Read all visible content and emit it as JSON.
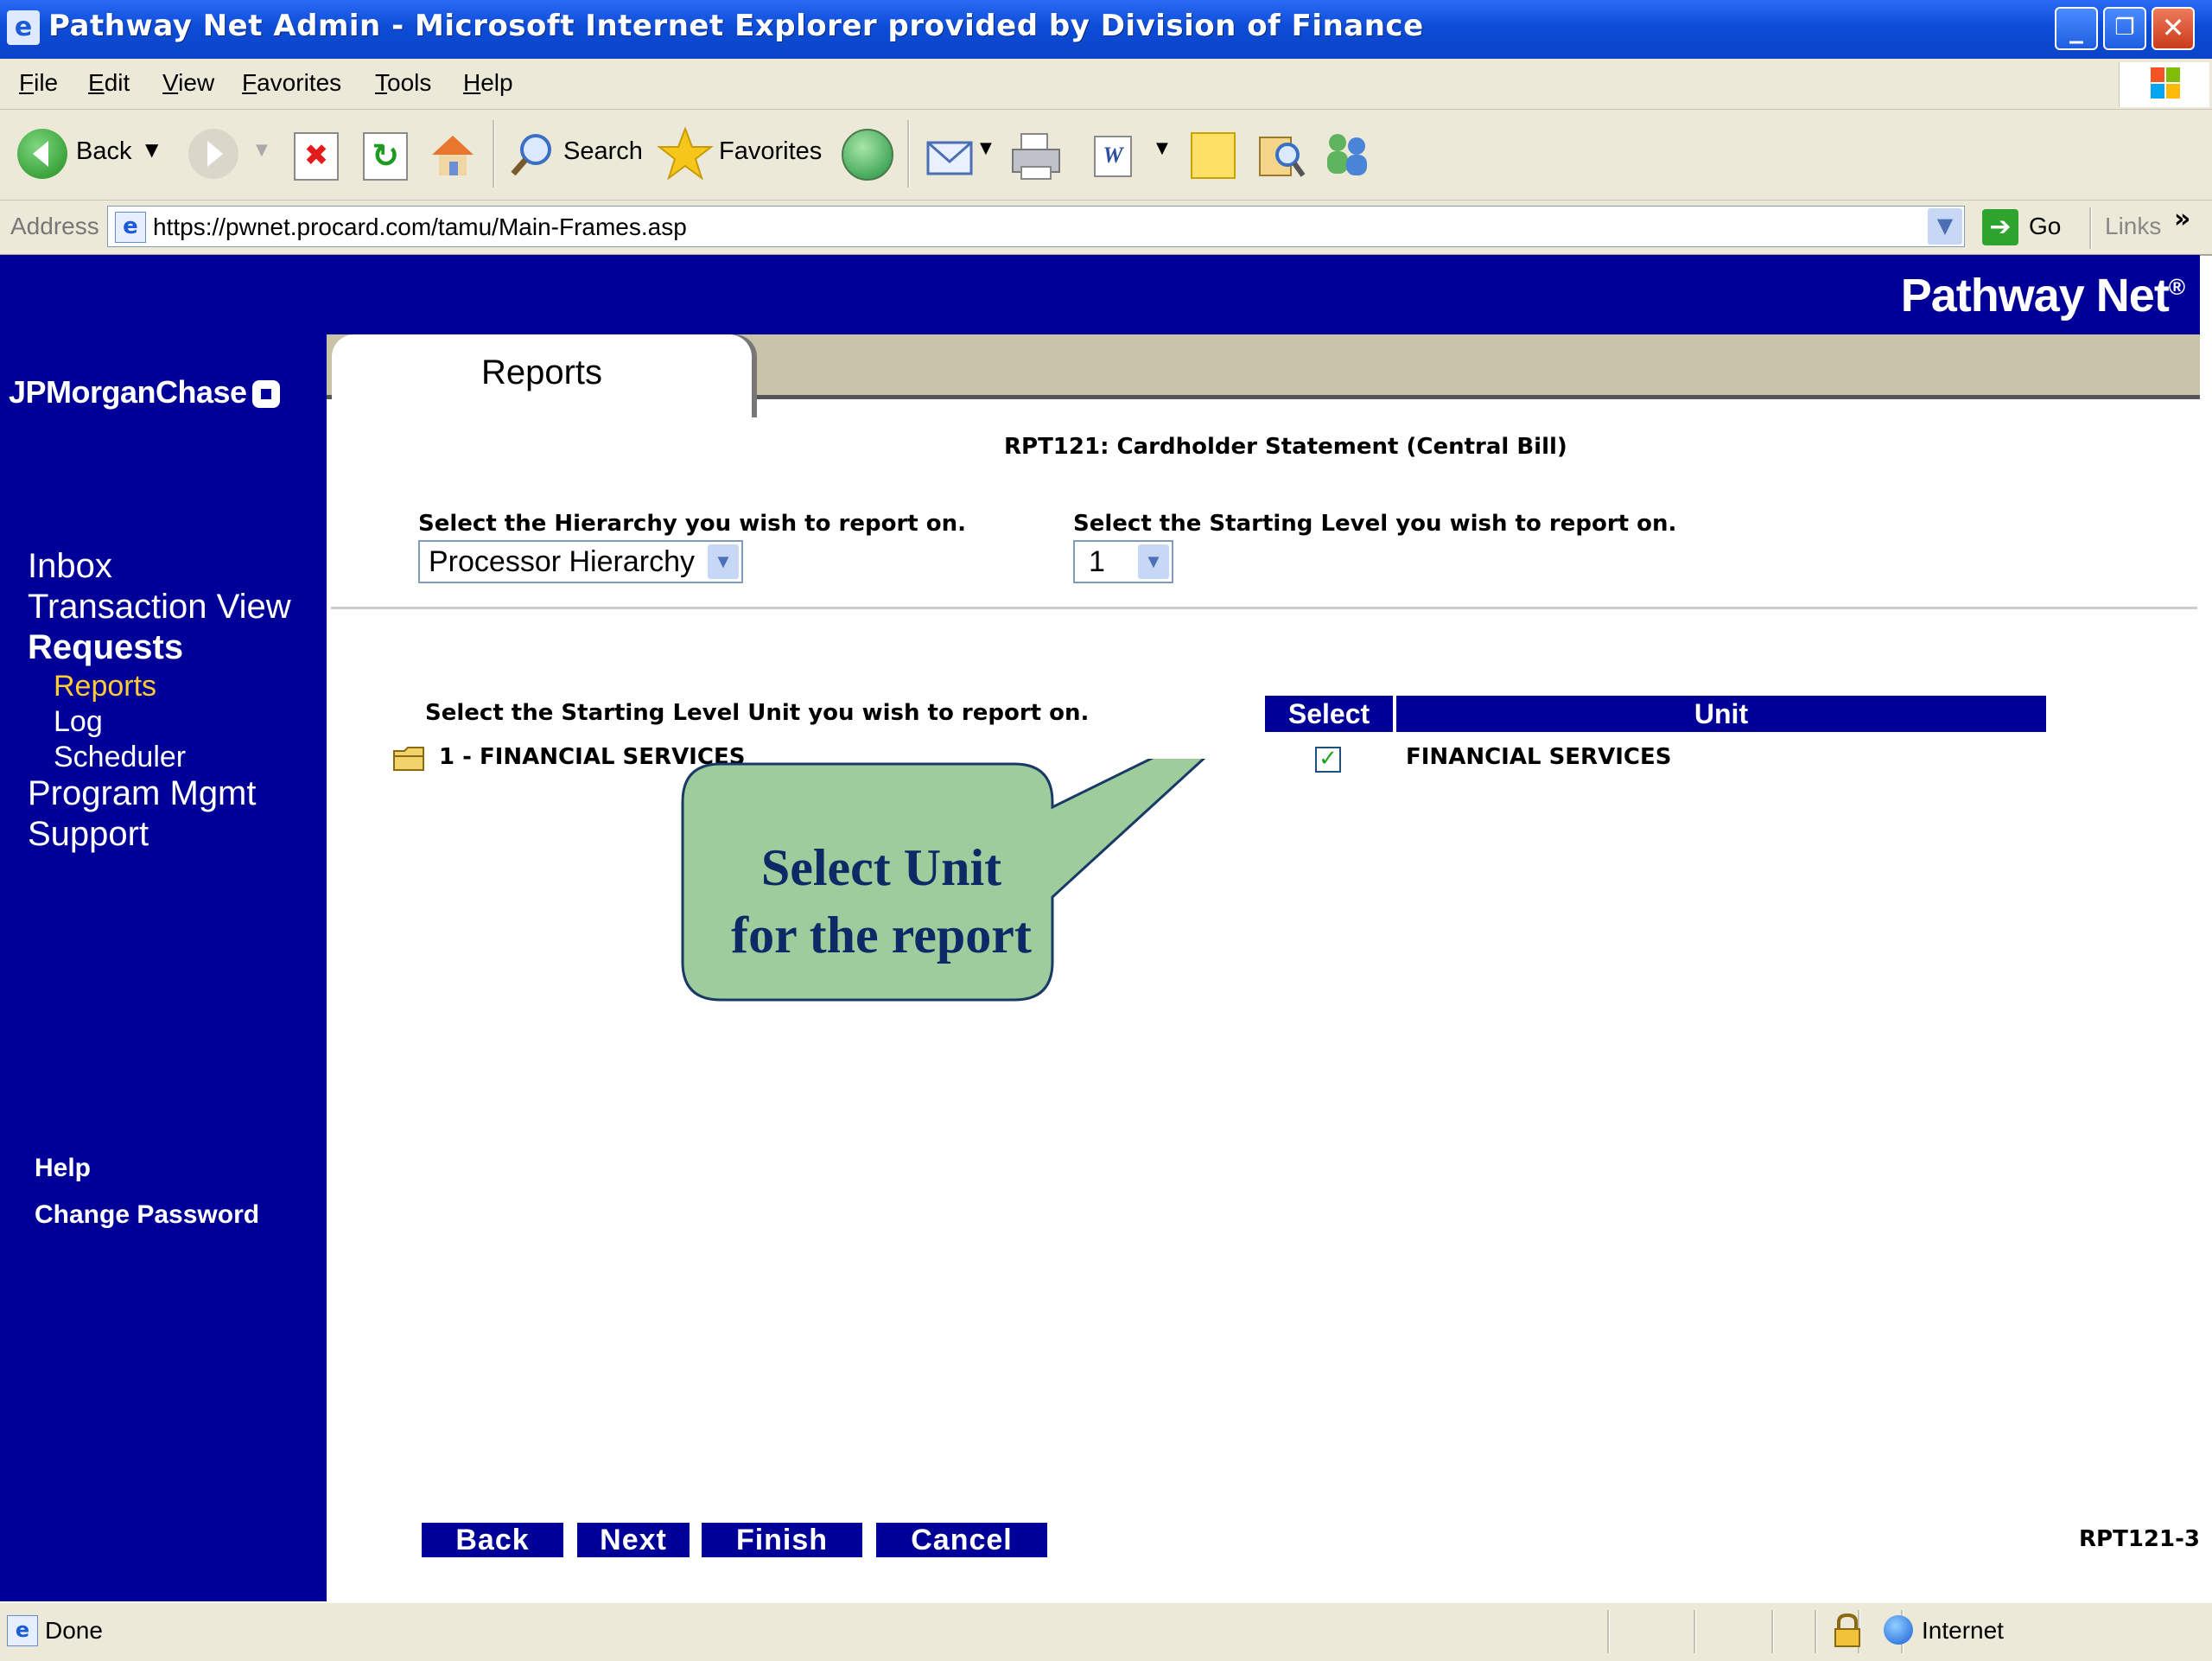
{
  "window": {
    "title": "Pathway Net Admin - Microsoft Internet Explorer provided by Division of Finance"
  },
  "menu": [
    "File",
    "Edit",
    "View",
    "Favorites",
    "Tools",
    "Help"
  ],
  "toolbar": {
    "back_label": "Back",
    "search_label": "Search",
    "favorites_label": "Favorites"
  },
  "address": {
    "label": "Address",
    "url": "https://pwnet.procard.com/tamu/Main-Frames.asp",
    "go_label": "Go",
    "links_label": "Links"
  },
  "brand": {
    "product": "Pathway Net",
    "reg": "®",
    "bank": "JPMorganChase"
  },
  "nav": {
    "inbox": "Inbox",
    "transaction_view": "Transaction View",
    "requests": "Requests",
    "reports": "Reports",
    "log": "Log",
    "scheduler": "Scheduler",
    "program_mgmt": "Program Mgmt",
    "support": "Support",
    "help": "Help",
    "change_password": "Change Password"
  },
  "tab": {
    "label": "Reports"
  },
  "report": {
    "title": "RPT121: Cardholder Statement (Central Bill)",
    "hierarchy_label": "Select the Hierarchy you wish to report on.",
    "hierarchy_value": "Processor Hierarchy",
    "level_label": "Select the Starting Level you wish to report on.",
    "level_value": "1",
    "unit_label": "Select the Starting Level Unit you wish to report on.",
    "tree_item": "1 - FINANCIAL SERVICES",
    "table_header_select": "Select",
    "table_header_unit": "Unit",
    "unit_name": "FINANCIAL SERVICES",
    "unit_checked": true,
    "page_code": "RPT121-3"
  },
  "callout": {
    "line1": "Select Unit",
    "line2": "for the report"
  },
  "buttons": {
    "back": "Back",
    "next": "Next",
    "finish": "Finish",
    "cancel": "Cancel"
  },
  "status": {
    "left": "Done",
    "zone": "Internet"
  },
  "colors": {
    "nav_bg": "#000099",
    "active_nav": "#ffcc33",
    "callout_fill": "#9dcc9d",
    "callout_text": "#0d2a66"
  }
}
